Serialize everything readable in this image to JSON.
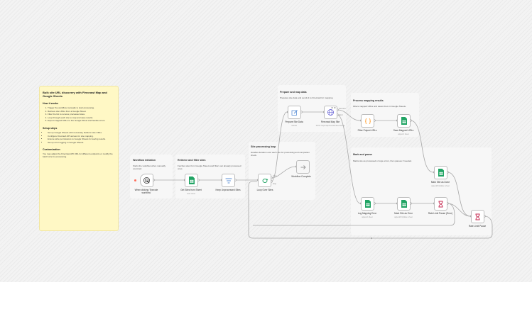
{
  "sticky": {
    "title": "Bulk site URL discovery with Firecrawl Map and Google Sheets",
    "how_heading": "How it works",
    "how_items": [
      "Trigger the workflow manually to start processing.",
      "Retrieve site URLs from a Google Sheet.",
      "Filter the list to remove processed sites.",
      "Loop through each site to map and save results.",
      "Export mapped URLs to the Google Sheet and handle errors."
    ],
    "setup_heading": "Setup steps",
    "setup_items": [
      "Set up Google Sheets with necessary fields for site URLs.",
      "Configure Firecrawl API access for site mapping.",
      "Ensure write permissions to Google Sheets for saving results.",
      "Set up error logging in Google Sheets."
    ],
    "custom_heading": "Customization",
    "custom_text": "You may adjust the Firecrawl API URL for different endpoints or modify the batch size for processing."
  },
  "sections": {
    "init": {
      "title": "Workflow initiation",
      "desc": "Starts the workflow when manually executed."
    },
    "retrieve": {
      "title": "Retrieve and filter sites",
      "desc": "Fetches sites from Google Sheets and filters out already processed ones."
    },
    "loop": {
      "title": "Site processing loop",
      "desc": "Handles iteration over each site for processing and completion check."
    },
    "prepare": {
      "title": "Prepare and map data",
      "desc": "Prepares site data and sends it to Firecrawl for mapping."
    },
    "process": {
      "title": "Process mapping results",
      "desc": "Filters mapped URLs and saves them in Google Sheets."
    },
    "mark": {
      "title": "Mark and pause",
      "desc": "Marks site as processed or logs errors, then pauses if needed."
    }
  },
  "nodes": {
    "trigger": {
      "label": "When clicking 'Execute workflow'",
      "icon": "pointer-click-icon"
    },
    "get_sites": {
      "label": "Get Sites from Sheet",
      "sub": "read: sheet",
      "icon": "google-sheets-icon"
    },
    "keep": {
      "label": "Keep Unprocessed Sites",
      "icon": "filter-icon"
    },
    "loop": {
      "label": "Loop Over Sites",
      "icon": "loop-icon"
    },
    "complete": {
      "label": "Workflow Complete",
      "icon": "no-op-arrow-icon"
    },
    "prepare": {
      "label": "Prepare Site Data",
      "sub": "manual",
      "icon": "edit-pen-icon"
    },
    "firecrawl": {
      "label": "Firecrawl Map Site",
      "sub": "POST: https://api.firecrawl.dev/v1/map",
      "icon": "globe-icon"
    },
    "filter_output": {
      "label": "Filter Project URLs",
      "icon": "code-braces-icon"
    },
    "save": {
      "label": "Save Mapped URLs",
      "sub": "append: sheet",
      "icon": "google-sheets-icon"
    },
    "mark_done": {
      "label": "Mark Site as Done",
      "sub": "appendOrUpdate: sheet",
      "icon": "google-sheets-icon"
    },
    "log_error": {
      "label": "Log Mapping Error",
      "sub": "append: sheet",
      "icon": "google-sheets-icon"
    },
    "mark_error": {
      "label": "Mark Site as Error",
      "sub": "appendOrUpdate: sheet",
      "icon": "google-sheets-icon"
    },
    "pause_error": {
      "label": "Rate Limit Pause (Error)",
      "icon": "hourglass-icon"
    },
    "pause": {
      "label": "Rate Limit Pause",
      "icon": "hourglass-icon"
    }
  },
  "edge_labels": {
    "done": "done",
    "loop": "loop",
    "success": "Success",
    "error": "Error"
  },
  "colors": {
    "sheets_green": "#21a464",
    "trigger_orange": "#ff6d5a",
    "accent_purple": "#7b61ff",
    "code_orange": "#ff9922",
    "wait_red": "#c4264d"
  }
}
